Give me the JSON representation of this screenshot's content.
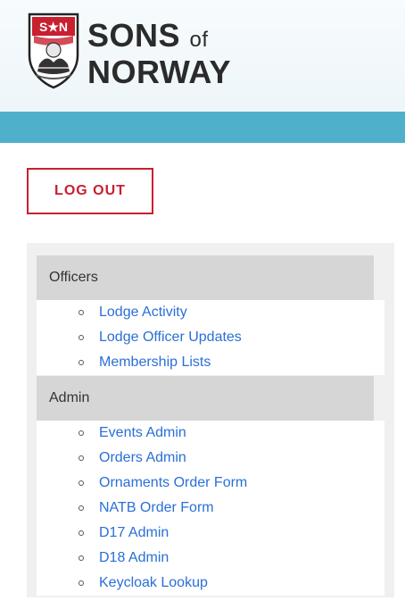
{
  "brand": {
    "line1": "SONS",
    "of": "of",
    "line2": "NORWAY",
    "logo_letters": "S★N"
  },
  "colors": {
    "teal": "#4fb0cc",
    "logout_red": "#c8202f",
    "link_blue": "#2a6fd6",
    "section_gray": "#d6d6d6",
    "panel_gray": "#f0f0f0"
  },
  "logout_label": "LOG OUT",
  "officers": {
    "title": "Officers",
    "items": [
      "Lodge Activity",
      "Lodge Officer Updates",
      "Membership Lists"
    ]
  },
  "admin": {
    "title": "Admin",
    "items": [
      "Events Admin",
      "Orders Admin",
      "Ornaments Order Form",
      "NATB Order Form",
      "D17 Admin",
      "D18 Admin",
      "Keycloak Lookup"
    ]
  }
}
